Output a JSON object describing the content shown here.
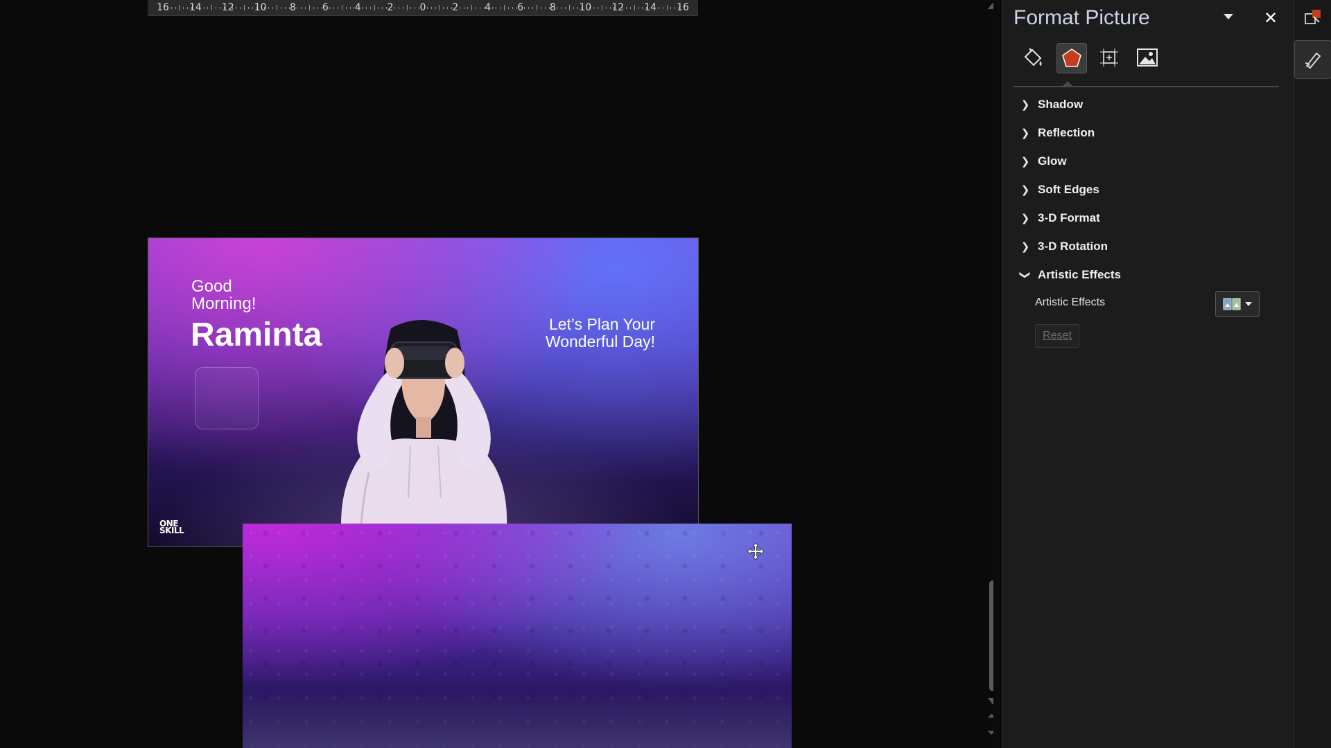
{
  "ruler": {
    "labels": [
      "16",
      "14",
      "12",
      "10",
      "8",
      "6",
      "4",
      "2",
      "0",
      "2",
      "4",
      "6",
      "8",
      "10",
      "12",
      "14",
      "16"
    ]
  },
  "slide": {
    "greeting": "Good Morning!",
    "name": "Raminta",
    "tagline": "Let’s Plan Your Wonderful Day!",
    "logo_line1": "ONE",
    "logo_line2": "SKILL"
  },
  "pane": {
    "title": "Format Picture",
    "tabs": [
      {
        "icon": "fill-line-icon"
      },
      {
        "icon": "effects-icon",
        "active": true
      },
      {
        "icon": "size-properties-icon"
      },
      {
        "icon": "picture-icon"
      }
    ],
    "sections": [
      {
        "label": "Shadow",
        "expanded": false
      },
      {
        "label": "Reflection",
        "expanded": false
      },
      {
        "label": "Glow",
        "expanded": false
      },
      {
        "label": "Soft Edges",
        "expanded": false
      },
      {
        "label": "3-D Format",
        "expanded": false
      },
      {
        "label": "3-D Rotation",
        "expanded": false
      },
      {
        "label": "Artistic Effects",
        "expanded": true
      }
    ],
    "artistic_effects_label": "Artistic Effects",
    "reset_label": "Reset"
  },
  "colors": {
    "accent": "#c43e1c",
    "pane_bg": "#1c1c1c",
    "title": "#cbd5e6"
  }
}
